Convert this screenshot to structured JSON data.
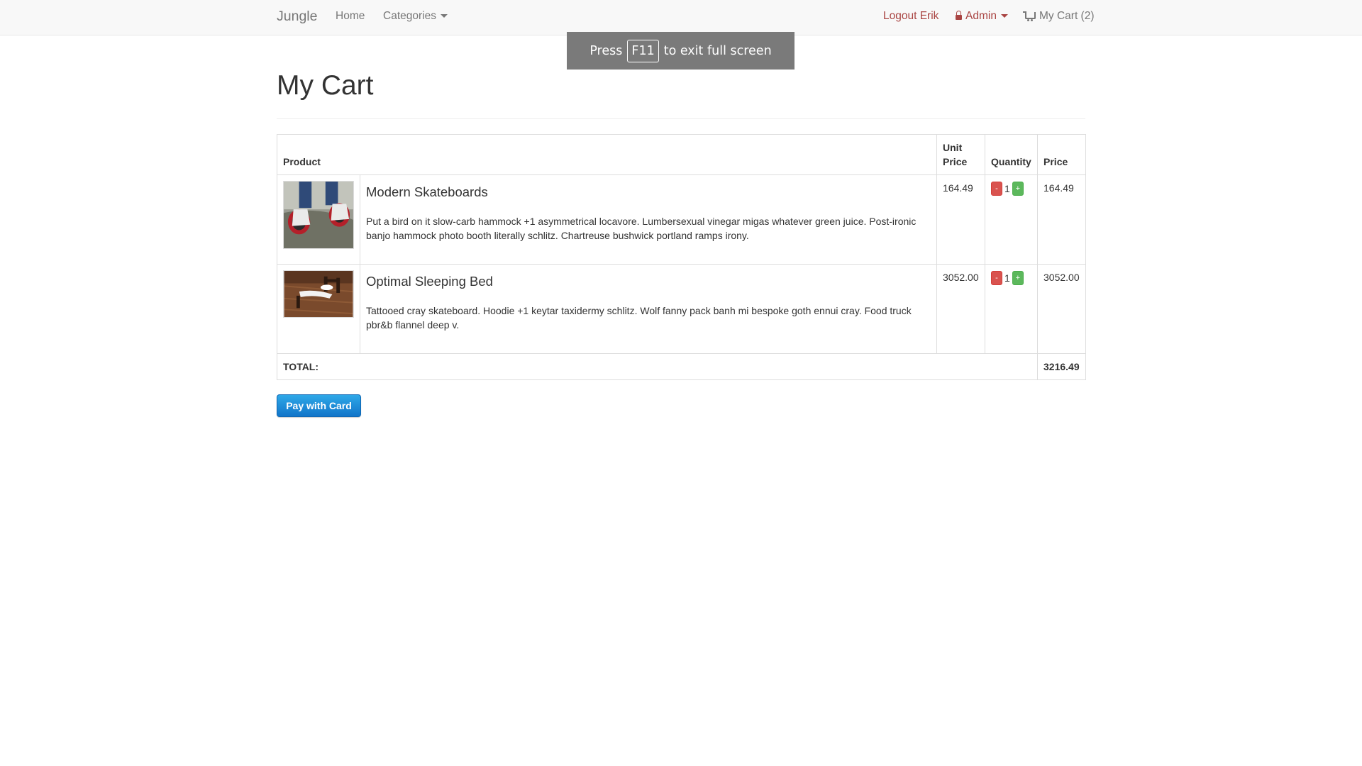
{
  "navbar": {
    "brand": "Jungle",
    "home": "Home",
    "categories": "Categories",
    "logout": "Logout Erik",
    "admin": "Admin",
    "cart": "My Cart (2)"
  },
  "overlay": {
    "press": "Press",
    "key": "F11",
    "rest": "to exit full screen"
  },
  "page": {
    "title": "My Cart"
  },
  "table": {
    "headers": {
      "product": "Product",
      "unit_price": "Unit Price",
      "quantity": "Quantity",
      "price": "Price"
    },
    "rows": [
      {
        "name": "Modern Skateboards",
        "description": "Put a bird on it slow-carb hammock +1 asymmetrical locavore. Lumbersexual vinegar migas whatever green juice. Post-ironic banjo hammock photo booth literally schlitz. Chartreuse bushwick portland ramps irony.",
        "unit_price": "164.49",
        "quantity": "1",
        "price": "164.49",
        "minus": "-",
        "plus": "+"
      },
      {
        "name": "Optimal Sleeping Bed",
        "description": "Tattooed cray skateboard. Hoodie +1 keytar taxidermy schlitz. Wolf fanny pack banh mi bespoke goth ennui cray. Food truck pbr&b flannel deep v.",
        "unit_price": "3052.00",
        "quantity": "1",
        "price": "3052.00",
        "minus": "-",
        "plus": "+"
      }
    ],
    "total_label": "TOTAL:",
    "total_value": "3216.49"
  },
  "pay_button": "Pay with Card",
  "colors": {
    "danger": "#d9534f",
    "success": "#5cb85c",
    "primary_blue": "#1275c9",
    "nav_red": "#a94442"
  }
}
